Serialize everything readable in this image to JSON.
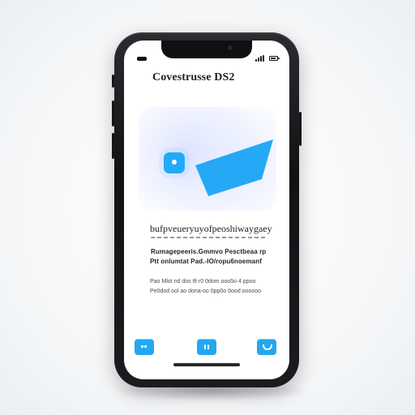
{
  "screen": {
    "title": "Covestrusse DS2"
  },
  "content": {
    "heading": "bufpveueryuyofpeoshiwaygaey",
    "body_line_1": "Rumagepeeris.Gmmvo Pesctbeaa rp",
    "body_line_2": "Ptt onlumtat Pad.-IO/ropu6noemanf",
    "caption_line_1": "Pao Mlot nd dos tfi r0 0dom ooo5o 4 ppoo",
    "caption_line_2": "Pe0dod ool ao dona-oo 0pp0o 0ood oooooo"
  },
  "icons": {
    "status_left": "status-left-icon",
    "signal": "signal-icon",
    "battery": "battery-icon",
    "hero_dot": "hero-dot-icon",
    "hero_shape": "hero-shape-icon",
    "action_left": "grid-icon",
    "action_center": "pause-icon",
    "action_right": "cup-icon"
  },
  "colors": {
    "accent": "#23a8f0",
    "phone": "#111214",
    "screen": "#ffffff"
  }
}
